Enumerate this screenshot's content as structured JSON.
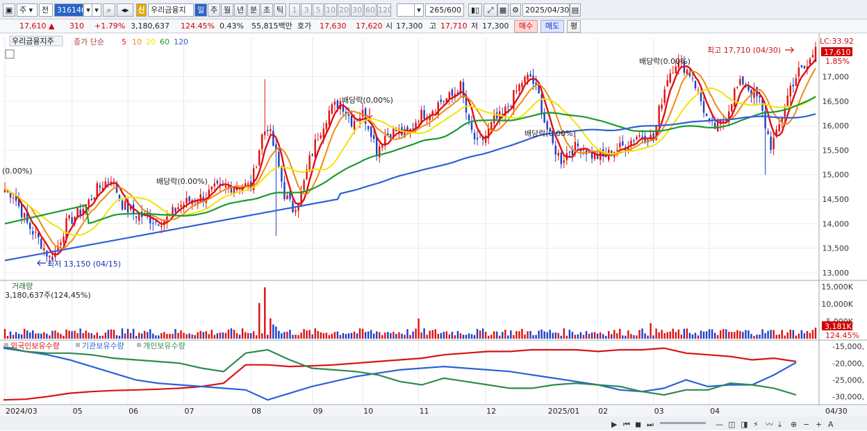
{
  "toolbar": {
    "market_tab": "주",
    "all_tab": "전",
    "code_input": "316140",
    "name": "우리금융지",
    "credit_badge": "신",
    "periods": [
      "일",
      "주",
      "월",
      "년",
      "분",
      "초",
      "틱"
    ],
    "active_period": "일",
    "minute_options": [
      "1",
      "3",
      "5",
      "10",
      "20",
      "30",
      "60",
      "120"
    ],
    "count_value": "265",
    "count_total": "/600",
    "date_value": "2025/04/30"
  },
  "quote": {
    "price": "17,610",
    "change": "310",
    "change_pct": "+1.79%",
    "volume": "3,180,637",
    "volume_ratio": "124.45%",
    "turnover": "0.43%",
    "amount": "55,815백만",
    "ask_label": "호가",
    "ask": "17,630",
    "bid": "17,620",
    "open_label": "시",
    "open": "17,300",
    "high_label": "고",
    "high": "17,710",
    "low_label": "저",
    "low": "17,300",
    "buy_button": "매수",
    "sell_button": "매도",
    "flat_button": "평"
  },
  "colors": {
    "up": "#e01010",
    "down": "#1e3fc8",
    "ma5": "#e01010",
    "ma10": "#f08a10",
    "ma20": "#f2e400",
    "ma60": "#1a9a30",
    "ma120": "#2f5fd8",
    "foreign": "#d71414",
    "inst": "#2f5fd8",
    "individual": "#2e8b4e"
  },
  "chart_data": [
    {
      "type": "candlestick",
      "title": "우리금융지주",
      "legend": [
        "종가 단순",
        "5",
        "10",
        "20",
        "60",
        "120"
      ],
      "x_tick_labels": [
        "2024/03",
        "05",
        "06",
        "07",
        "08",
        "09",
        "10",
        "11",
        "12",
        "2025/01",
        "02",
        "03",
        "04"
      ],
      "x_end_label": "04/30",
      "y_ticks": [
        "17,000",
        "16,500",
        "16,000",
        "15,500",
        "15,000",
        "14,500",
        "14,000",
        "13,500",
        "13,000"
      ],
      "ylim": [
        12900,
        17800
      ],
      "last_price": "17,610",
      "last_change": "1.85%",
      "lc_label": "LC:33.92",
      "annotations": [
        "최고 17,710 (04/30)",
        "최저 13,150 (04/15)",
        "배당락(0.00%)",
        "배당락(0,00%)",
        "(0.00%)",
        "배당락(0.00%)",
        "배당락(0.00%)"
      ],
      "close_anchors": [
        [
          0,
          14700
        ],
        [
          3,
          14600
        ],
        [
          8,
          14000
        ],
        [
          13,
          13600
        ],
        [
          16,
          13300
        ],
        [
          18,
          13400
        ],
        [
          22,
          14000
        ],
        [
          26,
          14200
        ],
        [
          30,
          14450
        ],
        [
          33,
          14700
        ],
        [
          38,
          14950
        ],
        [
          42,
          14400
        ],
        [
          46,
          14200
        ],
        [
          50,
          14150
        ],
        [
          54,
          14050
        ],
        [
          58,
          14100
        ],
        [
          62,
          14350
        ],
        [
          67,
          14500
        ],
        [
          71,
          14550
        ],
        [
          75,
          14700
        ],
        [
          80,
          14750
        ],
        [
          84,
          14800
        ],
        [
          88,
          14750
        ],
        [
          92,
          15800
        ],
        [
          94,
          16000
        ],
        [
          97,
          15400
        ],
        [
          100,
          14600
        ],
        [
          103,
          14300
        ],
        [
          106,
          14600
        ],
        [
          109,
          15300
        ],
        [
          112,
          15800
        ],
        [
          116,
          16300
        ],
        [
          120,
          16500
        ],
        [
          124,
          16100
        ],
        [
          128,
          16250
        ],
        [
          131,
          15900
        ],
        [
          133,
          15500
        ],
        [
          136,
          15800
        ],
        [
          140,
          15900
        ],
        [
          144,
          15800
        ],
        [
          148,
          16200
        ],
        [
          152,
          16300
        ],
        [
          156,
          16500
        ],
        [
          160,
          16600
        ],
        [
          163,
          16800
        ],
        [
          166,
          16000
        ],
        [
          169,
          15600
        ],
        [
          172,
          15800
        ],
        [
          175,
          16100
        ],
        [
          178,
          16200
        ],
        [
          181,
          16500
        ],
        [
          185,
          16900
        ],
        [
          188,
          17000
        ],
        [
          191,
          16600
        ],
        [
          193,
          16100
        ],
        [
          196,
          15600
        ],
        [
          199,
          15300
        ],
        [
          202,
          15500
        ],
        [
          206,
          15600
        ],
        [
          210,
          15400
        ],
        [
          214,
          15350
        ],
        [
          218,
          15500
        ],
        [
          222,
          15600
        ],
        [
          226,
          15800
        ],
        [
          230,
          15800
        ],
        [
          232,
          15700
        ],
        [
          234,
          16300
        ],
        [
          237,
          17000
        ],
        [
          240,
          17300
        ],
        [
          243,
          17200
        ],
        [
          246,
          17000
        ],
        [
          249,
          16500
        ],
        [
          252,
          16000
        ],
        [
          255,
          15950
        ],
        [
          258,
          16200
        ],
        [
          261,
          16700
        ],
        [
          264,
          16900
        ],
        [
          267,
          16700
        ],
        [
          270,
          16500
        ],
        [
          272,
          16000
        ],
        [
          274,
          15600
        ],
        [
          276,
          15800
        ],
        [
          278,
          16200
        ],
        [
          281,
          16800
        ],
        [
          284,
          17100
        ],
        [
          287,
          17200
        ],
        [
          290,
          17610
        ]
      ]
    },
    {
      "type": "bar",
      "title": "거래량",
      "current_label": "3,180,637주(124,45%)",
      "y_ticks": [
        "15,000K",
        "10,000K",
        "5,000K"
      ],
      "ylim": [
        0,
        16000
      ],
      "unit": "K shares",
      "last_value": "3,181K",
      "last_ratio": "124.45%",
      "spikes": [
        [
          91,
          10300
        ],
        [
          93,
          14800
        ],
        [
          95,
          5900
        ],
        [
          96,
          4100
        ],
        [
          97,
          3500
        ],
        [
          148,
          5800
        ],
        [
          231,
          4500
        ]
      ]
    },
    {
      "type": "line",
      "legend": [
        "외국인보유수량",
        "기관보유수량",
        "개인보유수량"
      ],
      "y_ticks": [
        "-15,000,",
        "-20,000,",
        "-25,000,",
        "-30,000,"
      ],
      "ylim": [
        -32000,
        -13500
      ],
      "unit": "thousand shares",
      "series": [
        {
          "name": "외국인보유수량",
          "values": [
            -31000,
            -30800,
            -30000,
            -29000,
            -28500,
            -28200,
            -28000,
            -27800,
            -27500,
            -27000,
            -26000,
            -20500,
            -20500,
            -21000,
            -20800,
            -20500,
            -20000,
            -19500,
            -19000,
            -18500,
            -17500,
            -17000,
            -16500,
            -16500,
            -16000,
            -16000,
            -16000,
            -16500,
            -16000,
            -16000,
            -15500,
            -17000,
            -17500,
            -18000,
            -19000,
            -18500,
            -19500
          ]
        },
        {
          "name": "기관보유수량",
          "values": [
            -15500,
            -16500,
            -17500,
            -19000,
            -21000,
            -23000,
            -25000,
            -26000,
            -26500,
            -27000,
            -27500,
            -28000,
            -31000,
            -29000,
            -27000,
            -25500,
            -24000,
            -23000,
            -22000,
            -21500,
            -21000,
            -21500,
            -22000,
            -22500,
            -23500,
            -24500,
            -25500,
            -26500,
            -28000,
            -28500,
            -27500,
            -25000,
            -27000,
            -26500,
            -26500,
            -23500,
            -19800
          ]
        },
        {
          "name": "개인보유수량",
          "values": [
            -15000,
            -16500,
            -17000,
            -17000,
            -17500,
            -18500,
            -19000,
            -19500,
            -20000,
            -21500,
            -22500,
            -17000,
            -16000,
            -19000,
            -21500,
            -22000,
            -22500,
            -23500,
            -25500,
            -26500,
            -24500,
            -25500,
            -26500,
            -27500,
            -27500,
            -26500,
            -26000,
            -26500,
            -27000,
            -28500,
            -29500,
            -28000,
            -28000,
            -26000,
            -26500,
            -27500,
            -29500
          ]
        }
      ]
    }
  ]
}
